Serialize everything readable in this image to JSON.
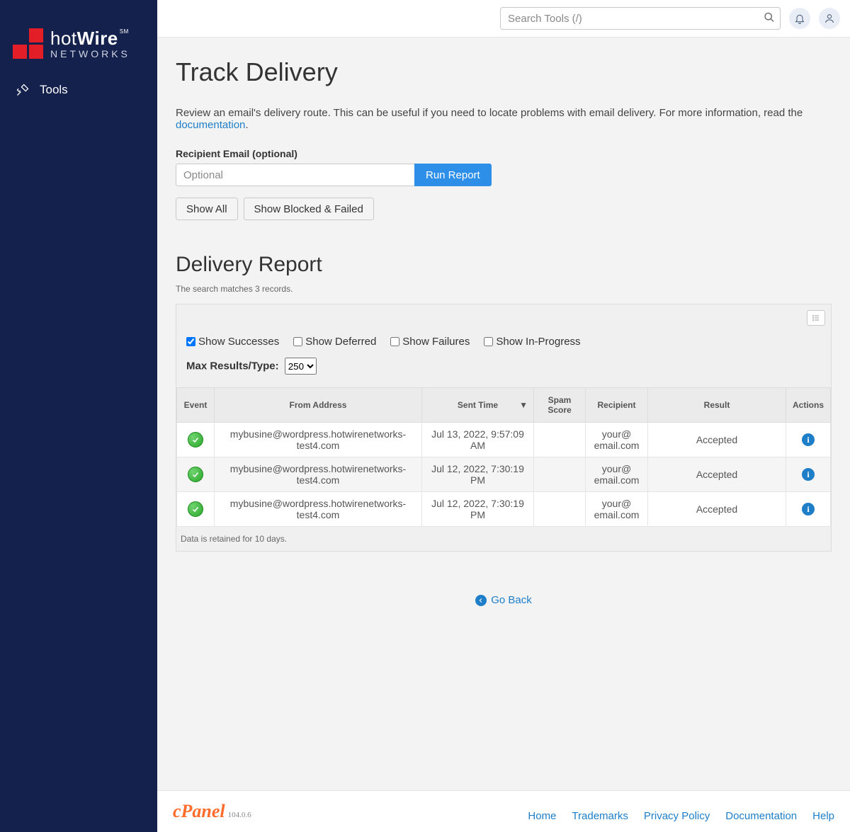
{
  "sidebar": {
    "brand_top": "hot",
    "brand_top2": "Wire",
    "brand_sm": "SM",
    "brand_bottom": "NETWORKS",
    "items": [
      {
        "label": "Tools"
      }
    ]
  },
  "topbar": {
    "search_placeholder": "Search Tools (/)"
  },
  "page": {
    "title": "Track Delivery",
    "intro_pre": "Review an email's delivery route. This can be useful if you need to locate problems with email delivery. For more information, read the ",
    "intro_link": "documentation",
    "intro_post": ".",
    "recipient_label": "Recipient Email (optional)",
    "recipient_placeholder": "Optional",
    "run_report": "Run Report",
    "show_all": "Show All",
    "show_blocked": "Show Blocked & Failed"
  },
  "report": {
    "heading": "Delivery Report",
    "match_text": "The search matches 3 records.",
    "filters": {
      "successes": "Show Successes",
      "deferred": "Show Deferred",
      "failures": "Show Failures",
      "inprogress": "Show In-Progress"
    },
    "max_label": "Max Results/Type:",
    "max_value": "250",
    "columns": {
      "event": "Event",
      "from": "From Address",
      "sent": "Sent Time",
      "spam": "Spam Score",
      "recipient": "Recipient",
      "result": "Result",
      "actions": "Actions"
    },
    "rows": [
      {
        "from": "mybusine@wordpress.hotwirenetworks-test4.com",
        "sent": "Jul 13, 2022, 9:57:09 AM",
        "spam": "",
        "recipient": "your@ email.com",
        "result": "Accepted"
      },
      {
        "from": "mybusine@wordpress.hotwirenetworks-test4.com",
        "sent": "Jul 12, 2022, 7:30:19 PM",
        "spam": "",
        "recipient": "your@ email.com",
        "result": "Accepted"
      },
      {
        "from": "mybusine@wordpress.hotwirenetworks-test4.com",
        "sent": "Jul 12, 2022, 7:30:19 PM",
        "spam": "",
        "recipient": "your@ email.com",
        "result": "Accepted"
      }
    ],
    "retain": "Data is retained for 10 days."
  },
  "goback": "Go Back",
  "footer": {
    "brand": "cPanel",
    "version": "104.0.6",
    "links": [
      "Home",
      "Trademarks",
      "Privacy Policy",
      "Documentation",
      "Help"
    ]
  }
}
